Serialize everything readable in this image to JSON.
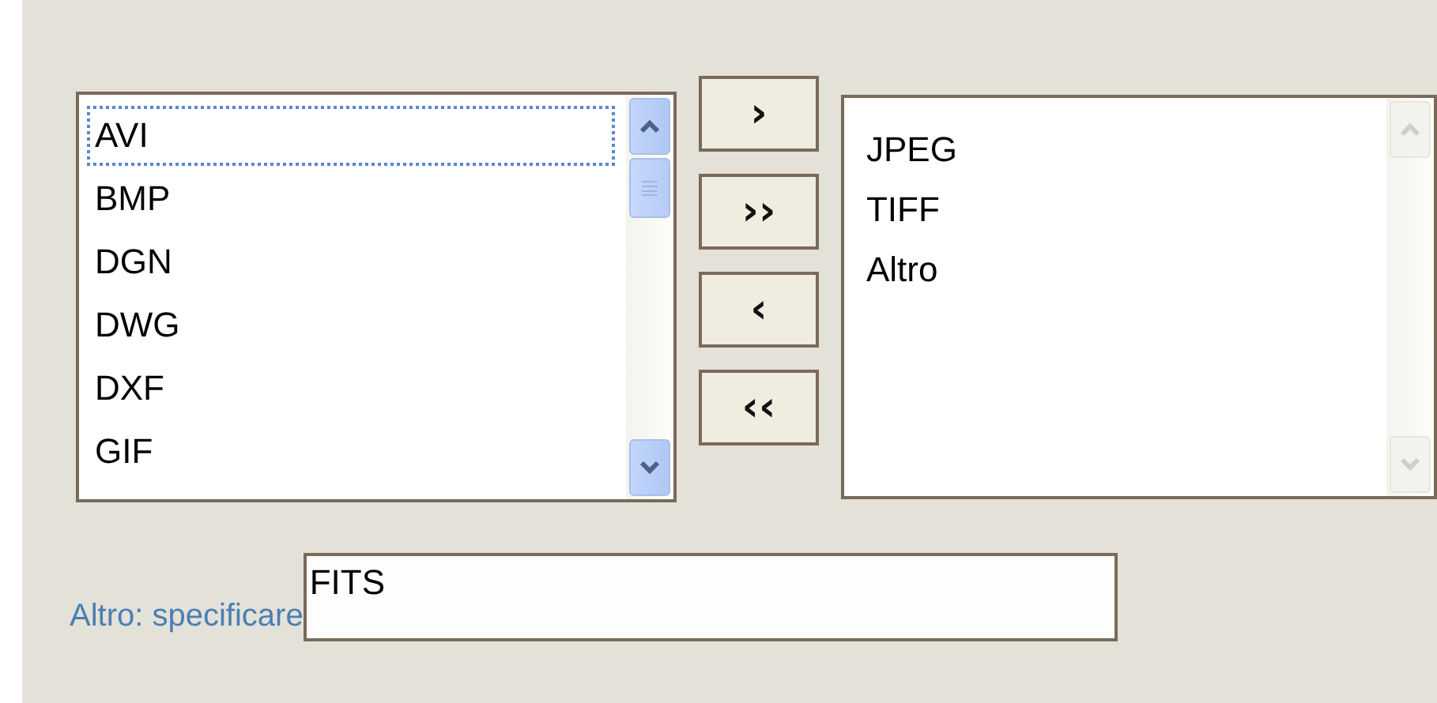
{
  "available_list": {
    "scrollable": true,
    "items": [
      {
        "label": "AVI",
        "focused": true
      },
      {
        "label": "BMP",
        "focused": false
      },
      {
        "label": "DGN",
        "focused": false
      },
      {
        "label": "DWG",
        "focused": false
      },
      {
        "label": "DXF",
        "focused": false
      },
      {
        "label": "GIF",
        "focused": false
      }
    ]
  },
  "move_buttons": [
    {
      "label": "›"
    },
    {
      "label": "››"
    },
    {
      "label": "‹"
    },
    {
      "label": "‹‹"
    }
  ],
  "chosen_list": {
    "scrollable": false,
    "items": [
      {
        "label": "JPEG",
        "focused": false
      },
      {
        "label": "TIFF",
        "focused": false
      },
      {
        "label": "Altro",
        "focused": false
      }
    ]
  },
  "other_field": {
    "label": "Altro: specificare",
    "value": "FITS"
  }
}
